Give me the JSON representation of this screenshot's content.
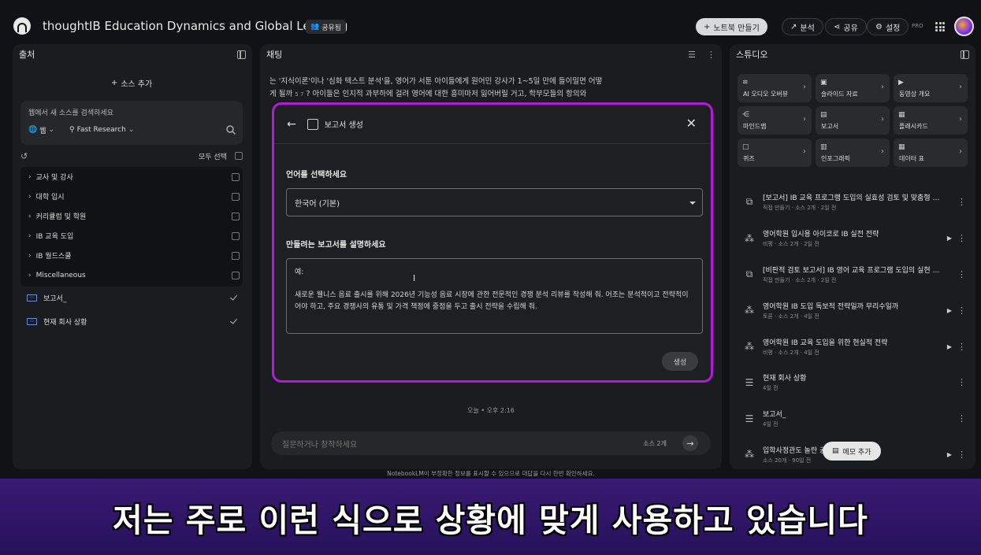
{
  "app": {
    "title": "thoughtIB Education Dynamics and Global Learning",
    "share_badge": "공유됨",
    "create_notebook": "노트북 만들기",
    "analyze": "분석",
    "share": "공유",
    "settings": "설정",
    "pro": "PRO"
  },
  "sources": {
    "title": "출처",
    "add_source": "소스 추가",
    "web_search_placeholder": "웹에서 새 소스를 검색하세요",
    "web_chip": "웹",
    "research_chip": "Fast Research",
    "select_all": "모두 선택",
    "folders": [
      "교사 및 강사",
      "대학 입시",
      "커리큘럼 및 학원",
      "IB 교육 도입",
      "IB 월드스쿨",
      "Miscellaneous"
    ],
    "items": [
      {
        "label": "보고서_",
        "checked": true
      },
      {
        "label": "현재 회사 상황",
        "checked": true
      }
    ]
  },
  "chat": {
    "title": "채팅",
    "text_line1": "는 '지식이론'이나 '심화 텍스트 분석'을, 영어가 서툰 아이들에게 원어민 강사가 1~5일 만에 들이밀면 어떻",
    "text_line2": "게 될까",
    "text_line2b": "? 아이들은 인지적 과부하에 걸려 영어에 대한 흥미마저 잃어버릴 거고, 학부모들의 항의와",
    "timestamp": "오늘 • 오후 2:16",
    "input_placeholder": "질문하거나 창작하세요",
    "source_count": "소스 2개",
    "disclaimer": "NotebookLM이 부정확한 정보를 표시할 수 있으므로 대답을 다시 한번 확인하세요."
  },
  "modal": {
    "title": "보고서 생성",
    "language_label": "언어를 선택하세요",
    "language_value": "한국어 (기본)",
    "describe_label": "만들려는 보고서를 설명하세요",
    "example_prefix": "예:",
    "example_text": "새로운 웰니스 음료 출시를 위해 2026년 기능성 음료 시장에 관한 전문적인 경쟁 분석 리뷰를 작성해 줘. 어조는 분석적이고 전략적이어야 하고, 주요 경쟁사의 유통 및 가격 책정에 중점을 두고 출시 전략을 수립해 줘.",
    "generate": "생성"
  },
  "studio": {
    "title": "스튜디오",
    "tiles": [
      {
        "label": "AI 오디오 오버뷰",
        "icon": "audio-wave-icon"
      },
      {
        "label": "슬라이드 자료",
        "icon": "slides-icon"
      },
      {
        "label": "동영상 개요",
        "icon": "video-icon"
      },
      {
        "label": "마인드맵",
        "icon": "mindmap-icon"
      },
      {
        "label": "보고서",
        "icon": "report-icon"
      },
      {
        "label": "플래시카드",
        "icon": "flashcard-icon"
      },
      {
        "label": "퀴즈",
        "icon": "quiz-icon"
      },
      {
        "label": "인포그래픽",
        "icon": "infographic-icon"
      },
      {
        "label": "데이터 표",
        "icon": "table-icon"
      }
    ],
    "notes": [
      {
        "title": "[보고서] IB 교육 프로그램 도입의 실효성 검토 및 맞춤형 실...",
        "sub": "직접 만들기 · 소스 2개 · 2일 전",
        "type": "report",
        "play": false
      },
      {
        "title": "영어학원 입시용 아이코로 IB 실전 전략",
        "sub": "비평 · 소스 2개 · 2일 전",
        "type": "audio",
        "play": true
      },
      {
        "title": "[비판적 검토 보고서] IB 영어 교육 프로그램 도입의 실현 가...",
        "sub": "직접 만들기 · 소스 2개 · 2일 전",
        "type": "report",
        "play": false
      },
      {
        "title": "영어학원 IB 도입 독보적 전략일까 무리수일까",
        "sub": "토론 · 소스 2개 · 4일 전",
        "type": "audio",
        "play": true
      },
      {
        "title": "영어학원 IB 교육 도입을 위한 현실적 전략",
        "sub": "비평 · 소스 2개 · 4일 전",
        "type": "audio",
        "play": true
      },
      {
        "title": "현재 회사 상황",
        "sub": "4일 전",
        "type": "note",
        "play": false
      },
      {
        "title": "보고서_",
        "sub": "4일 전",
        "type": "note",
        "play": false
      },
      {
        "title": "입학사정관도 놀란 공                    사례",
        "sub": "소스 20개 · 90일 전",
        "type": "audio",
        "play": true
      }
    ],
    "memo_button": "메모 추가"
  },
  "subtitle": "저는 주로 이런 식으로 상황에 맞게 사용하고 있습니다"
}
